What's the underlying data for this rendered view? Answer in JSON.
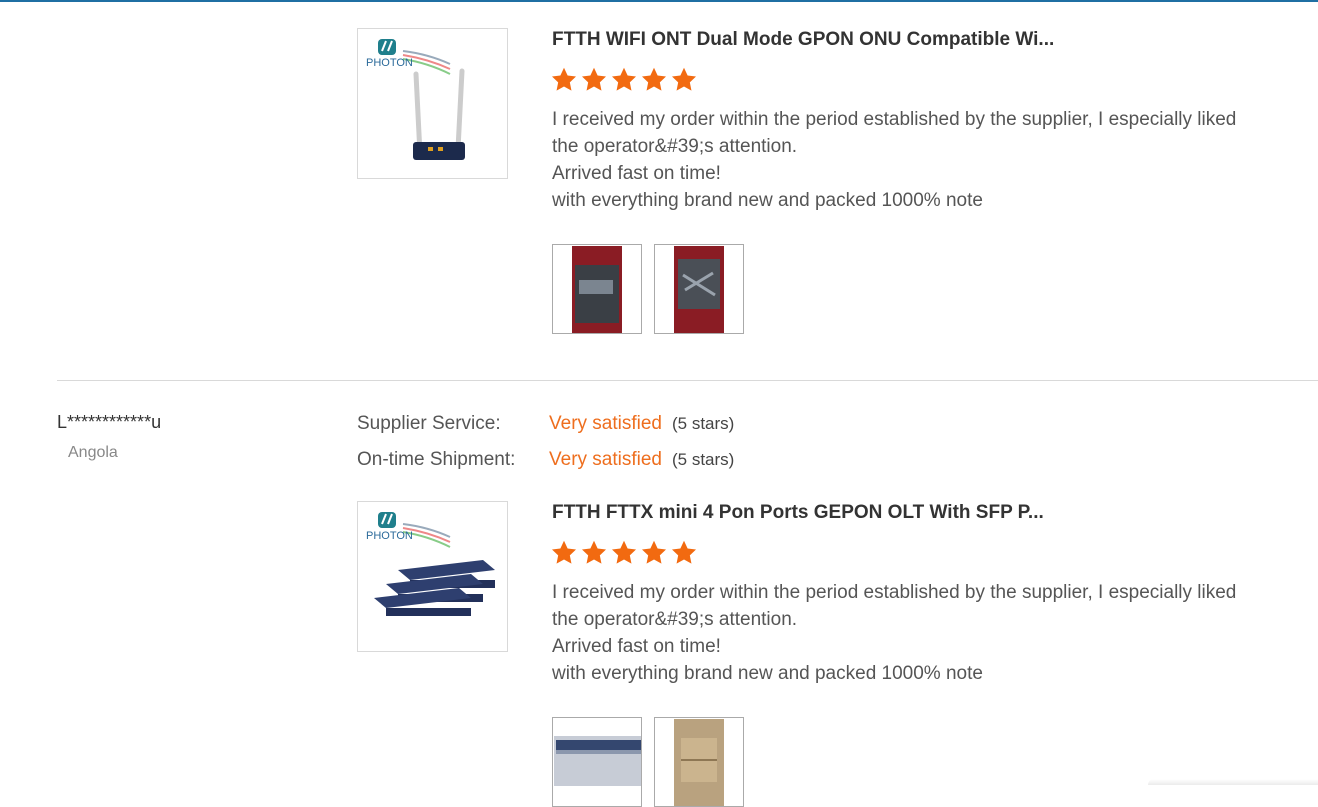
{
  "reviews": [
    {
      "product": {
        "title": "FTTH WIFI ONT Dual Mode GPON ONU Compatible Wi...",
        "brand_logo_text": "PHOTON",
        "thumbnail_icon": "wifi-router-image"
      },
      "stars": 5,
      "text_lines": [
        "I received my order within the period established by the supplier, I especially liked",
        "the operator&#39;s attention.",
        "Arrived fast on time!",
        "with everything brand new and packed 1000% note"
      ],
      "photos": [
        "package-photo-1",
        "package-photo-2"
      ]
    },
    {
      "reviewer": {
        "name": "L************u",
        "country": "Angola"
      },
      "ratings": [
        {
          "label": "Supplier Service:",
          "value": "Very satisfied",
          "stars_text": "(5 stars)"
        },
        {
          "label": "On-time Shipment:",
          "value": "Very satisfied",
          "stars_text": "(5 stars)"
        }
      ],
      "product": {
        "title": "FTTH FTTX mini 4 Pon Ports GEPON OLT With SFP P...",
        "brand_logo_text": "PHOTON",
        "thumbnail_icon": "olt-device-image"
      },
      "stars": 5,
      "text_lines": [
        "I received my order within the period established by the supplier, I especially liked",
        "the operator&#39;s attention.",
        "Arrived fast on time!",
        "with everything brand new and packed 1000% note"
      ],
      "photos": [
        "device-photo-1",
        "box-photo-2"
      ]
    }
  ],
  "colors": {
    "accent_orange": "#ee6e1e",
    "star_color": "#f26a10",
    "top_line": "#1f6fa3"
  }
}
